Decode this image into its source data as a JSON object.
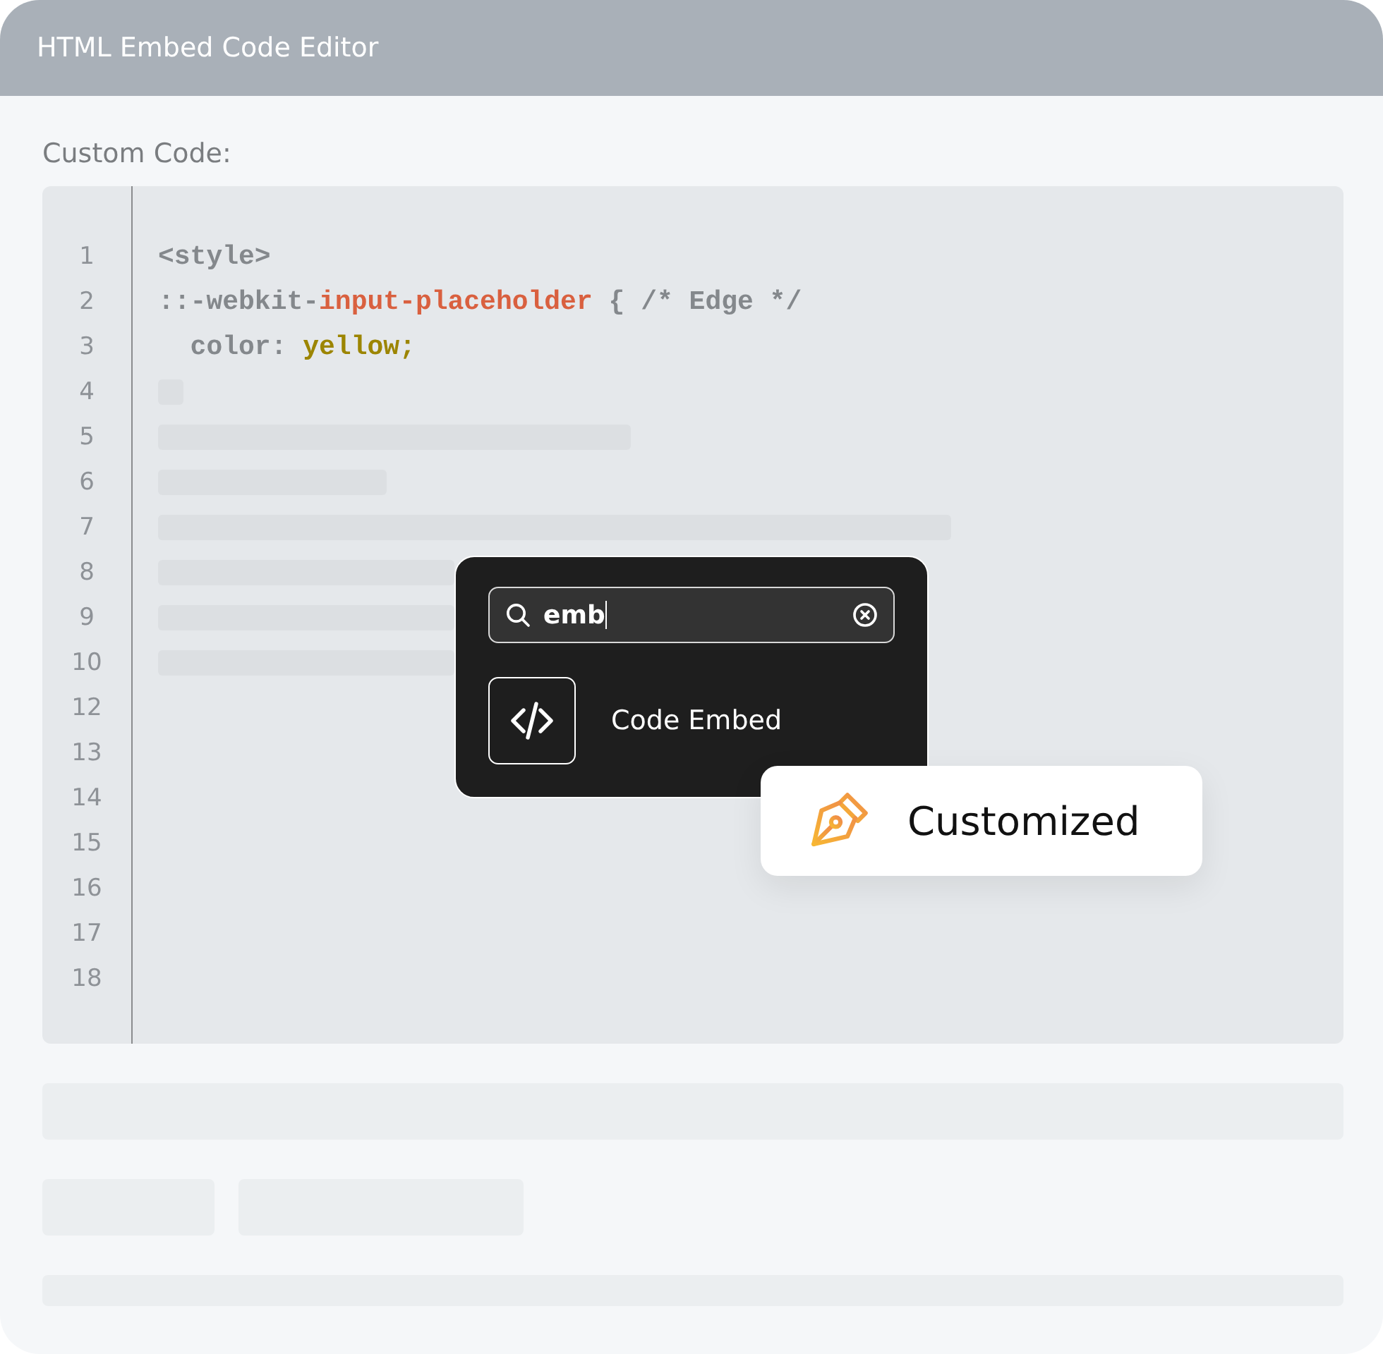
{
  "window": {
    "title": "HTML Embed Code Editor"
  },
  "editor": {
    "label": "Custom Code:",
    "lines": [
      {
        "number": "1",
        "tokens": [
          {
            "text": "<style>",
            "kind": "plain"
          }
        ]
      },
      {
        "number": "2",
        "tokens": [
          {
            "text": "::-webkit-",
            "kind": "plain"
          },
          {
            "text": "input-placeholder",
            "kind": "selector"
          },
          {
            "text": " { /* Edge */",
            "kind": "plain"
          }
        ]
      },
      {
        "number": "3",
        "tokens": [
          {
            "text": "  color: ",
            "kind": "plain"
          },
          {
            "text": "yellow;",
            "kind": "value"
          }
        ]
      },
      {
        "number": "4"
      },
      {
        "number": "5"
      },
      {
        "number": "6"
      },
      {
        "number": "7"
      },
      {
        "number": "8"
      },
      {
        "number": "9"
      },
      {
        "number": "10"
      },
      {
        "number": "12"
      },
      {
        "number": "13"
      },
      {
        "number": "14"
      },
      {
        "number": "15"
      },
      {
        "number": "16"
      },
      {
        "number": "17"
      },
      {
        "number": "18"
      }
    ]
  },
  "popup": {
    "search": {
      "value": "emb"
    },
    "results": [
      {
        "label": "Code Embed"
      }
    ]
  },
  "badge": {
    "label": "Customized"
  }
}
